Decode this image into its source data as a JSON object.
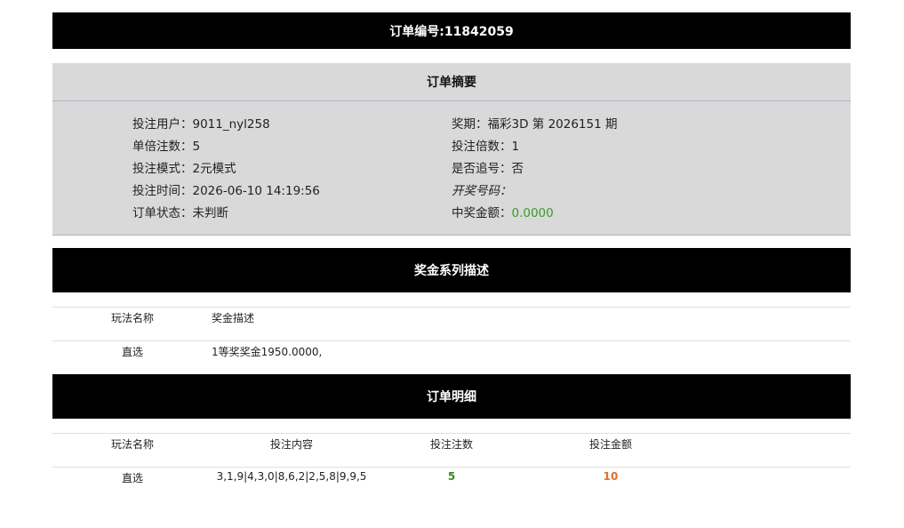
{
  "order": {
    "title": "订单编号:11842059"
  },
  "summary": {
    "title": "订单摘要",
    "left": [
      {
        "label": "投注用户：",
        "value": "9011_nyl258"
      },
      {
        "label": "单倍注数：",
        "value": "5"
      },
      {
        "label": "投注模式：",
        "value": "2元模式"
      },
      {
        "label": "投注时间：",
        "value": "2026-06-10 14:19:56"
      },
      {
        "label": "订单状态：",
        "value": "未判断"
      }
    ],
    "right": [
      {
        "label": "奖期：",
        "value": "福彩3D 第 2026151 期"
      },
      {
        "label": "投注倍数：",
        "value": "1"
      },
      {
        "label": "是否追号：",
        "value": "否"
      },
      {
        "label": "开奖号码：",
        "value": ""
      },
      {
        "label": "中奖金额：",
        "value": "0.0000"
      }
    ]
  },
  "prize_section": {
    "title": "奖金系列描述",
    "headers": [
      "玩法名称",
      "奖金描述"
    ],
    "rows": [
      [
        "直选",
        "1等奖奖金1950.0000,"
      ]
    ]
  },
  "detail_section": {
    "title": "订单明细",
    "headers": [
      "玩法名称",
      "投注内容",
      "投注注数",
      "投注金额"
    ],
    "rows": [
      [
        "直选",
        "3,1,9|4,3,0|8,6,2|2,5,8|9,9,5",
        "5",
        "10"
      ]
    ]
  },
  "colors": {
    "header_bar": "#000000",
    "summary_bg": "#d9d9d9",
    "win_amount": "#3a9a2a",
    "count_green": "#3a8a1a",
    "amount_orange": "#e0702a"
  }
}
